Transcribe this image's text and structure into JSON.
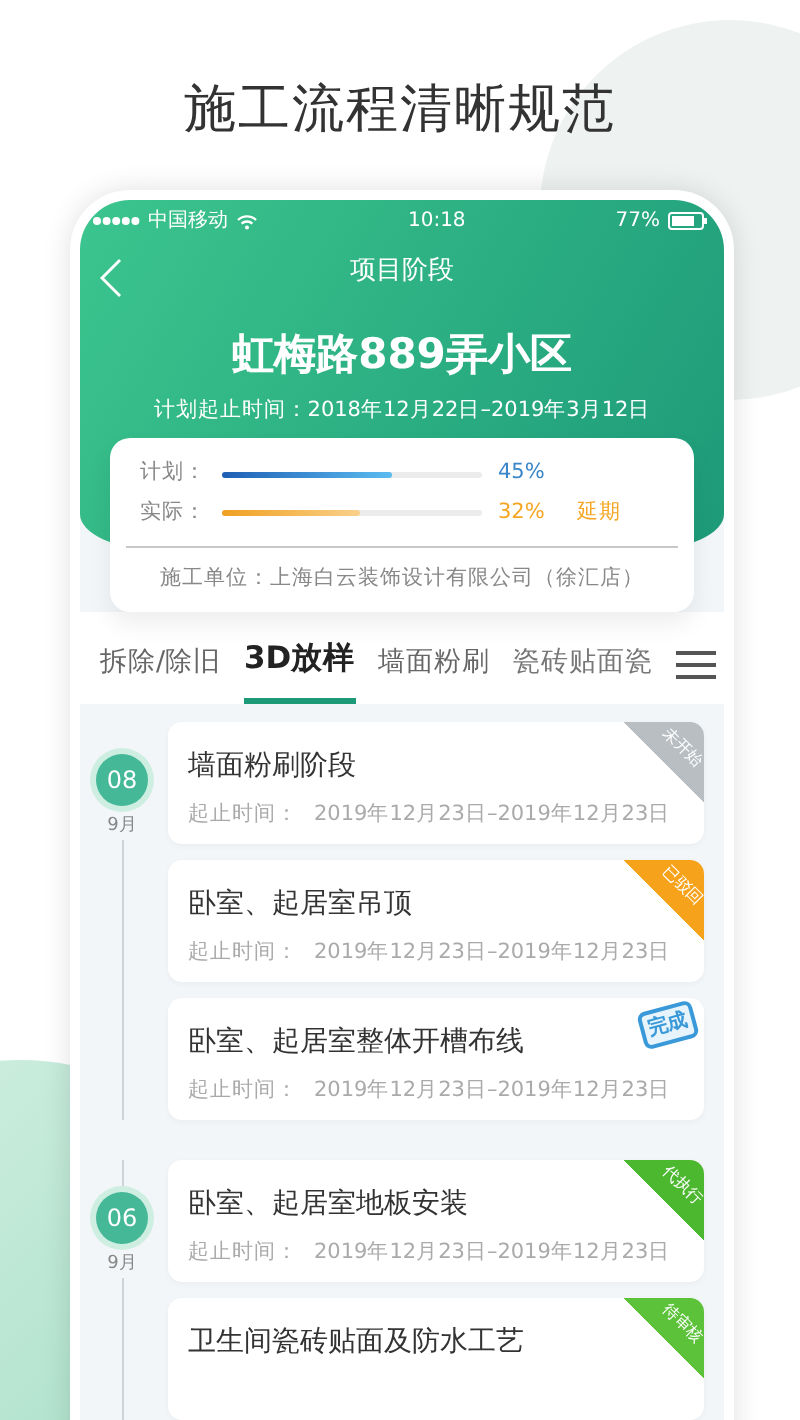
{
  "headline": "施工流程清晰规范",
  "status_bar": {
    "carrier": "中国移动",
    "time": "10:18",
    "battery": "77%"
  },
  "nav": {
    "title": "项目阶段"
  },
  "project": {
    "name": "虹梅路889弄小区",
    "period": "计划起止时间：2018年12月22日–2019年3月12日"
  },
  "progress": [
    {
      "label": "计划：",
      "level": 0.65,
      "reading": "45%",
      "kind": "plan"
    },
    {
      "label": "实际：",
      "level": 0.53,
      "reading": "32%",
      "kind": "actual",
      "note": "延期"
    }
  ],
  "contractor": "施工单位：上海白云装饰设计有限公司（徐汇店）",
  "tabs": [
    {
      "label": "拆除/除旧",
      "selected": false
    },
    {
      "label": "3D放样",
      "selected": true
    },
    {
      "label": "墙面粉刷",
      "selected": false
    },
    {
      "label": "瓷砖贴面瓷",
      "selected": false
    }
  ],
  "timeline": [
    {
      "day": "08",
      "month": "9月",
      "tasks": [
        {
          "title": "墙面粉刷阶段",
          "time_label": "起止时间：",
          "time": "2019年12月23日–2019年12月23日",
          "status": "未开始",
          "kind": "ribbon",
          "color": "#b9bec3"
        },
        {
          "title": "卧室、起居室吊顶",
          "time_label": "起止时间：",
          "time": "2019年12月23日–2019年12月23日",
          "status": "已驳回",
          "kind": "ribbon",
          "color": "#f7a21b"
        },
        {
          "title": "卧室、起居室整体开槽布线",
          "time_label": "起止时间：",
          "time": "2019年12月23日–2019年12月23日",
          "status": "完成",
          "kind": "stamp",
          "color": "#3a9ad9"
        }
      ]
    },
    {
      "day": "06",
      "month": "9月",
      "tasks": [
        {
          "title": "卧室、起居室地板安装",
          "time_label": "起止时间：",
          "time": "2019年12月23日–2019年12月23日",
          "status": "代执行",
          "kind": "ribbon",
          "color": "#4cb82f"
        },
        {
          "title": "卫生间瓷砖贴面及防水工艺",
          "status": "待审核",
          "kind": "ribbon",
          "color": "#5cc23a"
        }
      ]
    }
  ]
}
